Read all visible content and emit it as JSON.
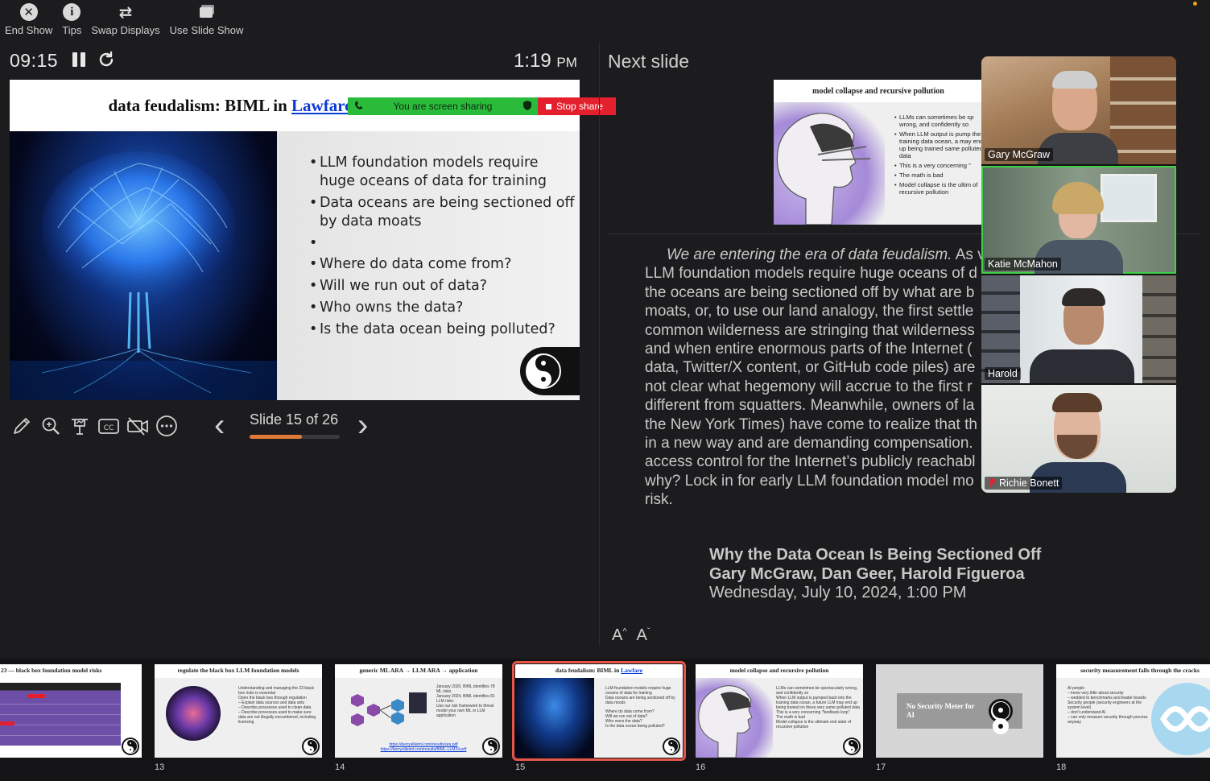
{
  "toolbar": {
    "end_show": "End Show",
    "tips": "Tips",
    "swap_displays": "Swap Displays",
    "use_slide_show": "Use Slide Show"
  },
  "timer": {
    "elapsed": "09:15",
    "clock_time": "1:19",
    "clock_ampm": "PM"
  },
  "current_slide": {
    "title_prefix": "data feudalism: BIML in ",
    "title_link": "Lawfare",
    "bullets_top": [
      "LLM foundation models require huge oceans of data for training",
      "Data oceans are being sectioned off by data moats"
    ],
    "bullets_bottom": [
      "Where do data come from?",
      "Will we run out of data?",
      "Who owns the data?",
      "Is the data ocean being polluted?"
    ]
  },
  "screen_share": {
    "status": "You are screen sharing",
    "stop": "Stop share"
  },
  "slide_nav": {
    "counter": "Slide 15 of 26",
    "current": 15,
    "total": 26
  },
  "next_slide": {
    "label": "Next slide",
    "title": "model collapse and recursive pollution",
    "bullets": [
      "LLMs can sometimes be sp wrong, and confidently so",
      "When LLM output is pump the training data ocean, a may end up being trained same polluted data",
      "This is a very concerning \"",
      "The math is bad",
      "Model collapse is the ultim of recursive pollution"
    ]
  },
  "notes": {
    "lines": [
      "We are entering the era of data feudalism.",
      " As v",
      "LLM foundation models require huge oceans of d",
      "the oceans are being sectioned off by what are b",
      "moats, or, to use our land analogy, the first settle",
      "common wilderness are stringing that wilderness",
      "and when entire enormous parts of the Internet (",
      "data, Twitter/X content, or GitHub code piles) are",
      "not clear what hegemony will accrue to the first r",
      "different from squatters. Meanwhile, owners of la",
      "the New York Times) have come to realize that th",
      "in a new way and are demanding compensation.",
      "access control for the Internet’s publicly reachabl",
      "why? Lock in for early LLM foundation model mo",
      "risk."
    ],
    "credit_title": "Why the Data Ocean Is Being Sectioned Off",
    "credit_authors": "Gary McGraw, Dan Geer, Harold Figueroa",
    "credit_date": "Wednesday, July 10, 2024, 1:00 PM",
    "font_up": "A",
    "font_down": "A"
  },
  "participants": [
    {
      "name": "Gary McGraw",
      "muted": false,
      "active": false
    },
    {
      "name": "Katie McMahon",
      "muted": false,
      "active": true
    },
    {
      "name": "Harold",
      "muted": false,
      "active": false
    },
    {
      "name": "Richie Bonett",
      "muted": true,
      "active": false
    }
  ],
  "thumbnails": [
    {
      "num": "",
      "title": "23 — black box foundation model risks"
    },
    {
      "num": "13",
      "title": "regulate the black box LLM  foundation models",
      "bullets": [
        "Understanding and managing the 23 black box risks is essential",
        "Open the black box through regulation",
        "– Explain data sources and data sets",
        "– Describe processes used to clean data",
        "– Describe processes used to make sure data are not illegally encumbered, including licensing"
      ]
    },
    {
      "num": "14",
      "title": "generic ML ARA → LLM ARA → application",
      "bullets": [
        "January 2020, BIML identifies 78 ML risks",
        "January 2024, BIML identifies 81 LLM risks",
        "Use our risk framework to threat model your own ML or LLM application"
      ],
      "links": [
        "https://berryvilleiml.com/results/ara.pdf",
        "https://berryvilleiml.com/results/BIML-LLM24.pdf"
      ]
    },
    {
      "num": "15",
      "title_prefix": "data feudalism: BIML in ",
      "title_link": "Lawfare",
      "bullets": [
        "LLM foundation models require huge oceans of data for training",
        "Data oceans are being sectioned off by data moats",
        "Where do data come from?",
        "Will we run out of data?",
        "Who owns the data?",
        "Is the data ocean being polluted?"
      ]
    },
    {
      "num": "16",
      "title": "model collapse and recursive pollution",
      "bullets": [
        "LLMs can sometimes be spectacularly wrong, and confidently so",
        "When LLM output is pumped back into the training data ocean, a future LLM may end up being trained on these very same polluted data",
        "This is a very concerning \"feedback loop\"",
        "The math is bad",
        "Model collapse is the ultimate end state of recursive pollution"
      ]
    },
    {
      "num": "17",
      "banner": "No Security Meter for AI"
    },
    {
      "num": "18",
      "title": "security measurement falls through the cracks",
      "bullets": [
        "AI people",
        "– know very little about security",
        "– wedded to benchmarks and leader boards",
        "Security people (security engineers at the system level)",
        "– don't understand AI",
        "– can only measure security through process anyway"
      ]
    }
  ],
  "colors": {
    "share_green": "#2bbb3a",
    "share_red": "#e5202e",
    "progress": "#e07a36",
    "active_speaker": "#3fd04a",
    "current_thumb": "#e4564a"
  }
}
